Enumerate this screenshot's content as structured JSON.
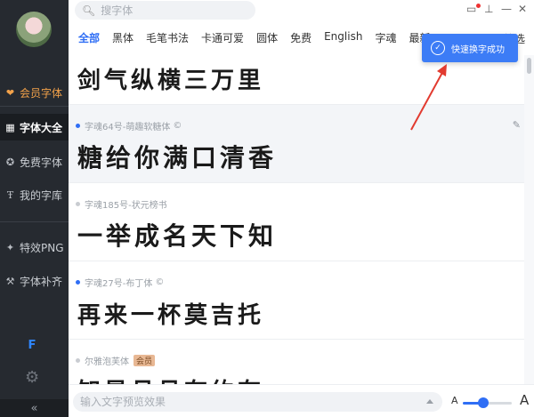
{
  "search": {
    "placeholder": "搜字体"
  },
  "sidebar": {
    "items": [
      {
        "label": "会员字体",
        "icon": "heart-diamond-icon"
      },
      {
        "label": "字体大全",
        "icon": "grid-icon"
      },
      {
        "label": "免费字体",
        "icon": "badge-icon"
      },
      {
        "label": "我的字库",
        "icon": "font-tt-icon"
      },
      {
        "label": "特效PNG",
        "icon": "magic-wand-icon"
      },
      {
        "label": "字体补齐",
        "icon": "wrench-icon"
      }
    ],
    "collapse_glyph": "«"
  },
  "tabs": [
    "全部",
    "黑体",
    "毛笔书法",
    "卡通可爱",
    "圆体",
    "免费",
    "English",
    "字魂",
    "最新"
  ],
  "tab_more": "筛选",
  "toast": {
    "text": "快速换字成功"
  },
  "fonts": [
    {
      "name": "",
      "preview": "剑气纵横三万里"
    },
    {
      "name": "字魂64号-萌趣软糖体",
      "preview": "糖给你满口清香"
    },
    {
      "name": "字魂185号-状元榜书",
      "preview": "一举成名天下知"
    },
    {
      "name": "字魂27号-布丁体",
      "preview": "再来一杯莫吉托"
    },
    {
      "name": "尔雅泡芙体",
      "badge": "会员",
      "preview": "知是月月有约有"
    }
  ],
  "bottom": {
    "placeholder": "输入文字预览效果",
    "size_small": "A",
    "size_large": "A",
    "size_level": 0.42
  },
  "colors": {
    "accent": "#2f6ef5",
    "sidebar_bg": "#262a30",
    "vip": "#f3a24a",
    "toast_bg": "#3c7cf6"
  }
}
